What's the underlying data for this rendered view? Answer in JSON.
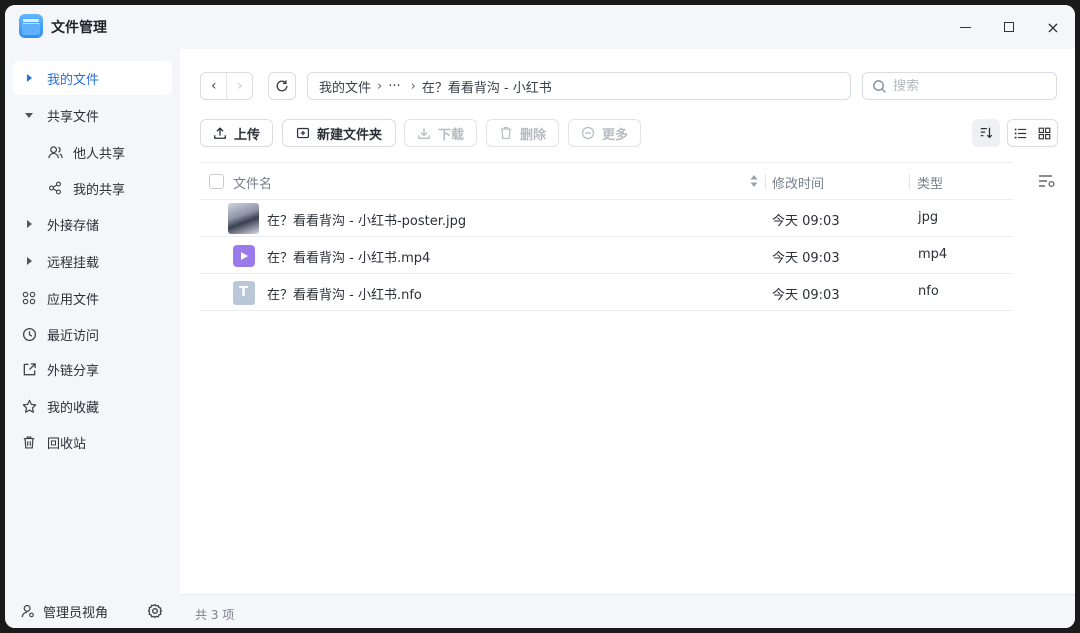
{
  "app": {
    "title": "文件管理"
  },
  "window_controls": {
    "minimize": "minimize",
    "maximize": "maximize",
    "close": "×"
  },
  "sidebar": {
    "items": [
      {
        "label": "我的文件",
        "icon": "triangle-right-icon",
        "active": true
      },
      {
        "label": "共享文件",
        "icon": "triangle-down-icon"
      },
      {
        "label": "他人共享",
        "icon": "users-icon",
        "sub": true
      },
      {
        "label": "我的共享",
        "icon": "share-icon",
        "sub": true
      },
      {
        "label": "外接存储",
        "icon": "triangle-right-icon"
      },
      {
        "label": "远程挂载",
        "icon": "triangle-right-icon"
      },
      {
        "label": "应用文件",
        "icon": "apps-icon"
      },
      {
        "label": "最近访问",
        "icon": "clock-icon"
      },
      {
        "label": "外链分享",
        "icon": "external-link-icon"
      },
      {
        "label": "我的收藏",
        "icon": "star-icon"
      },
      {
        "label": "回收站",
        "icon": "trash-icon"
      }
    ],
    "footer": {
      "label": "管理员视角",
      "icon": "admin-user-icon",
      "settings_icon": "gear-icon"
    }
  },
  "navigation": {
    "back": "‹",
    "forward": "›",
    "refresh_icon": "refresh-icon",
    "breadcrumb": [
      "我的文件",
      "···",
      "在？看看背沟 - 小红书"
    ],
    "breadcrumb_separator": "›"
  },
  "search": {
    "placeholder": "搜索"
  },
  "toolbar": {
    "upload": "上传",
    "new_folder": "新建文件夹",
    "download": "下载",
    "delete": "删除",
    "more": "更多"
  },
  "table": {
    "headers": {
      "name": "文件名",
      "mtime": "修改时间",
      "type": "类型"
    },
    "rows": [
      {
        "name": "在？看看背沟 - 小红书-poster.jpg",
        "mtime": "今天 09:03",
        "type": "jpg",
        "thumb": "image-thumbnail"
      },
      {
        "name": "在？看看背沟 - 小红书.mp4",
        "mtime": "今天 09:03",
        "type": "mp4",
        "thumb": "video-file-icon"
      },
      {
        "name": "在？看看背沟 - 小红书.nfo",
        "mtime": "今天 09:03",
        "type": "nfo",
        "thumb": "text-file-icon",
        "thumb_letter": "T"
      }
    ]
  },
  "status": {
    "count": "共 3 项"
  },
  "colors": {
    "accent": "#2a6fdb",
    "sidebar_bg": "#f5f6fa",
    "video_icon": "#9b7bea",
    "text_icon": "#b9c7d8"
  }
}
